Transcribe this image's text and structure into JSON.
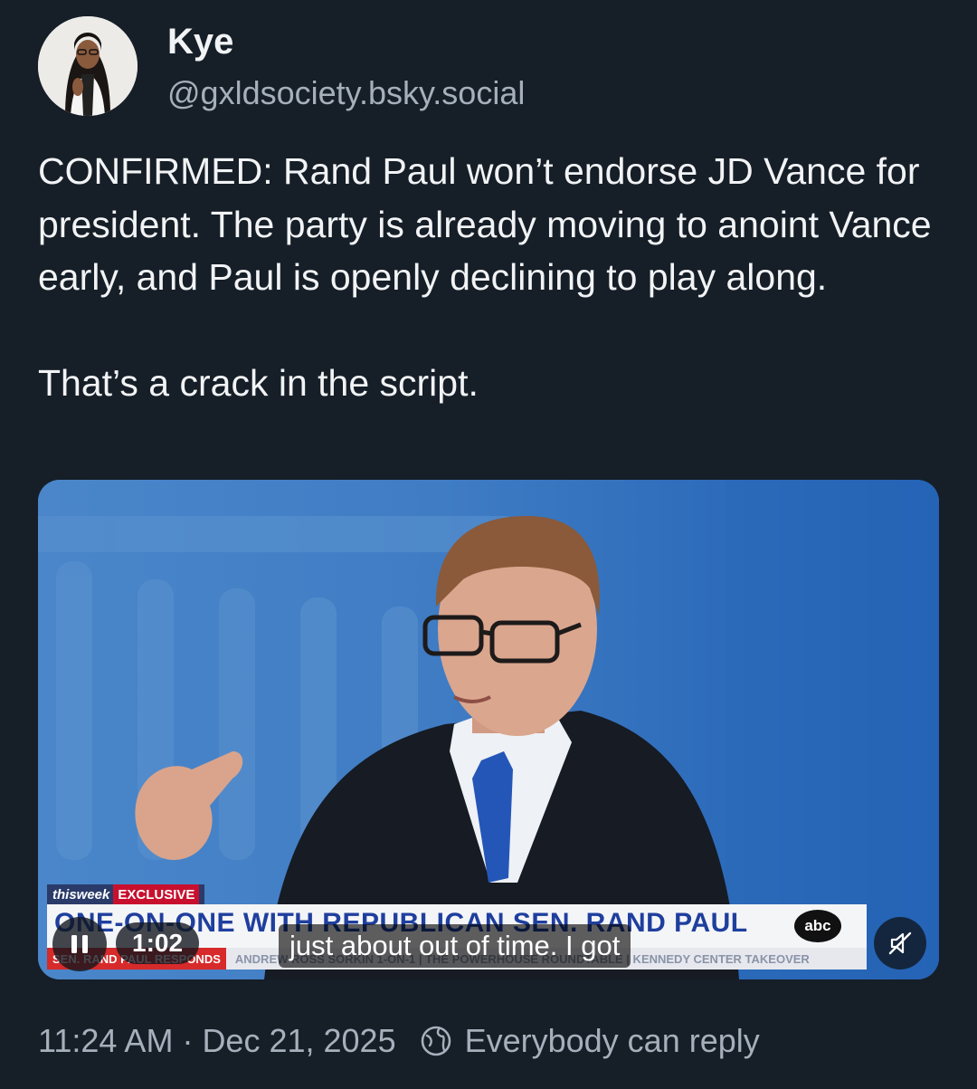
{
  "author": {
    "display_name": "Kye",
    "handle": "@gxldsociety.bsky.social"
  },
  "post": {
    "paragraphs": [
      "CONFIRMED: Rand Paul won’t endorse JD Vance for president. The party is already moving to anoint Vance early, and Paul is openly declining to play along.",
      "That’s a crack in the script."
    ]
  },
  "video": {
    "show_name": "thisweek",
    "exclusive_label": "EXCLUSIVE",
    "headline": "ONE-ON-ONE WITH REPUBLICAN SEN. RAND PAUL",
    "network_logo": "abc",
    "ticker_label": "SEN. RAND PAUL RESPONDS",
    "ticker_items": "ANDREW ROSS SORKIN 1-ON-1 | THE POWERHOUSE ROUNDTABLE | KENNEDY CENTER TAKEOVER",
    "caption": "just about out of time. I got",
    "time": "1:02",
    "play_state_icon": "pause-icon",
    "mute_icon": "muted-speaker-icon"
  },
  "footer": {
    "time": "11:24 AM",
    "separator": "·",
    "date": "Dec 21, 2025",
    "reply_setting": "Everybody can reply",
    "reply_icon": "globe-icon"
  },
  "colors": {
    "background": "#161e27",
    "text_primary": "#f1f3f5",
    "text_secondary": "#a6b0bc",
    "abc_red": "#c8102e",
    "abc_blue": "#1f3f9e"
  }
}
